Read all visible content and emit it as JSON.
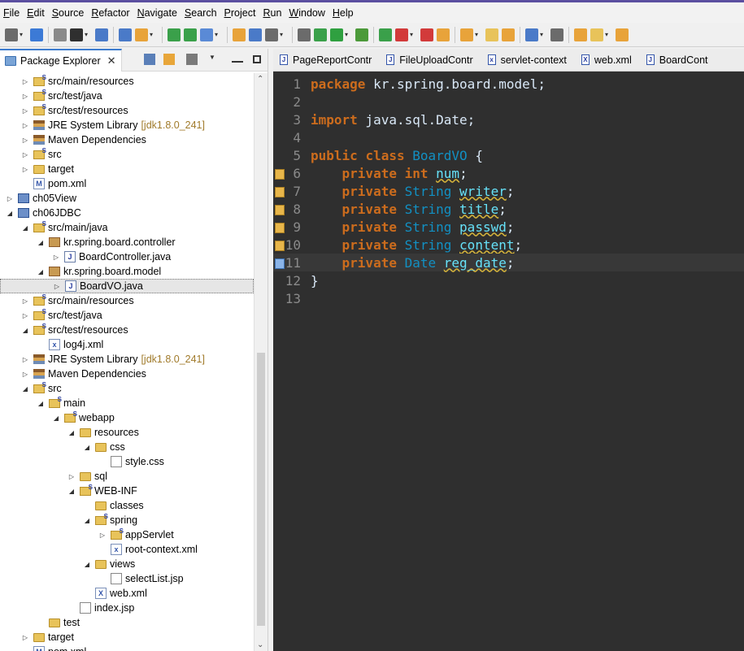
{
  "menu": [
    "File",
    "Edit",
    "Source",
    "Refactor",
    "Navigate",
    "Search",
    "Project",
    "Run",
    "Window",
    "Help"
  ],
  "explorer": {
    "tab_label": "Package Explorer",
    "close_glyph": "✕",
    "rows": [
      {
        "indent": 2,
        "twisty": "closed",
        "icon": "srcfolder",
        "label": "src/main/resources"
      },
      {
        "indent": 2,
        "twisty": "closed",
        "icon": "srcfolder",
        "label": "src/test/java"
      },
      {
        "indent": 2,
        "twisty": "closed",
        "icon": "srcfolder",
        "label": "src/test/resources"
      },
      {
        "indent": 2,
        "twisty": "closed",
        "icon": "lib",
        "label": "JRE System Library",
        "extra": "[jdk1.8.0_241]"
      },
      {
        "indent": 2,
        "twisty": "closed",
        "icon": "lib",
        "label": "Maven Dependencies"
      },
      {
        "indent": 2,
        "twisty": "closed",
        "icon": "srcfolder",
        "label": "src"
      },
      {
        "indent": 2,
        "twisty": "closed",
        "icon": "folder",
        "label": "target"
      },
      {
        "indent": 2,
        "twisty": "none",
        "icon": "xml",
        "label": "pom.xml",
        "glyph": "M"
      },
      {
        "indent": 1,
        "twisty": "closed",
        "icon": "project",
        "label": "ch05View"
      },
      {
        "indent": 1,
        "twisty": "open",
        "icon": "project",
        "label": "ch06JDBC"
      },
      {
        "indent": 2,
        "twisty": "open",
        "icon": "srcfolder",
        "label": "src/main/java"
      },
      {
        "indent": 3,
        "twisty": "open",
        "icon": "pkg",
        "label": "kr.spring.board.controller"
      },
      {
        "indent": 4,
        "twisty": "closed",
        "icon": "java",
        "label": "BoardController.java",
        "glyph": "J"
      },
      {
        "indent": 3,
        "twisty": "open",
        "icon": "pkg",
        "label": "kr.spring.board.model"
      },
      {
        "indent": 4,
        "twisty": "closed",
        "icon": "java",
        "label": "BoardVO.java",
        "glyph": "J",
        "selected": true
      },
      {
        "indent": 2,
        "twisty": "closed",
        "icon": "srcfolder",
        "label": "src/main/resources"
      },
      {
        "indent": 2,
        "twisty": "closed",
        "icon": "srcfolder",
        "label": "src/test/java"
      },
      {
        "indent": 2,
        "twisty": "open",
        "icon": "srcfolder",
        "label": "src/test/resources"
      },
      {
        "indent": 3,
        "twisty": "none",
        "icon": "xml",
        "label": "log4j.xml",
        "glyph": "x"
      },
      {
        "indent": 2,
        "twisty": "closed",
        "icon": "lib",
        "label": "JRE System Library",
        "extra": "[jdk1.8.0_241]"
      },
      {
        "indent": 2,
        "twisty": "closed",
        "icon": "lib",
        "label": "Maven Dependencies"
      },
      {
        "indent": 2,
        "twisty": "open",
        "icon": "srcfolder",
        "label": "src"
      },
      {
        "indent": 3,
        "twisty": "open",
        "icon": "srcfolder",
        "label": "main"
      },
      {
        "indent": 4,
        "twisty": "open",
        "icon": "srcfolder",
        "label": "webapp"
      },
      {
        "indent": 5,
        "twisty": "open",
        "icon": "folder",
        "label": "resources"
      },
      {
        "indent": 6,
        "twisty": "open",
        "icon": "folder",
        "label": "css"
      },
      {
        "indent": 7,
        "twisty": "none",
        "icon": "file",
        "label": "style.css"
      },
      {
        "indent": 5,
        "twisty": "closed",
        "icon": "folder",
        "label": "sql"
      },
      {
        "indent": 5,
        "twisty": "open",
        "icon": "srcfolder",
        "label": "WEB-INF"
      },
      {
        "indent": 6,
        "twisty": "none",
        "icon": "folder",
        "label": "classes"
      },
      {
        "indent": 6,
        "twisty": "open",
        "icon": "srcfolder",
        "label": "spring"
      },
      {
        "indent": 7,
        "twisty": "closed",
        "icon": "srcfolder",
        "label": "appServlet"
      },
      {
        "indent": 7,
        "twisty": "none",
        "icon": "xml",
        "label": "root-context.xml",
        "glyph": "x"
      },
      {
        "indent": 6,
        "twisty": "open",
        "icon": "folder",
        "label": "views"
      },
      {
        "indent": 7,
        "twisty": "none",
        "icon": "file",
        "label": "selectList.jsp"
      },
      {
        "indent": 6,
        "twisty": "none",
        "icon": "xml",
        "label": "web.xml",
        "glyph": "X"
      },
      {
        "indent": 5,
        "twisty": "none",
        "icon": "file",
        "label": "index.jsp"
      },
      {
        "indent": 3,
        "twisty": "none",
        "icon": "folder",
        "label": "test"
      },
      {
        "indent": 2,
        "twisty": "closed",
        "icon": "folder",
        "label": "target"
      },
      {
        "indent": 2,
        "twisty": "none",
        "icon": "xml",
        "label": "pom.xml",
        "glyph": "M"
      }
    ]
  },
  "editor": {
    "tabs": [
      {
        "label": "PageReportContr",
        "glyph": "J"
      },
      {
        "label": "FileUploadContr",
        "glyph": "J"
      },
      {
        "label": "servlet-context",
        "glyph": "x"
      },
      {
        "label": "web.xml",
        "glyph": "X"
      },
      {
        "label": "BoardCont",
        "glyph": "J"
      }
    ],
    "lines": [
      {
        "n": "1",
        "tokens": [
          [
            "kw",
            "package"
          ],
          [
            "t",
            " kr.spring.board.model;"
          ]
        ]
      },
      {
        "n": "2",
        "tokens": []
      },
      {
        "n": "3",
        "tokens": [
          [
            "kw",
            "import"
          ],
          [
            "t",
            " java.sql.Date;"
          ]
        ]
      },
      {
        "n": "4",
        "tokens": []
      },
      {
        "n": "5",
        "tokens": [
          [
            "kw",
            "public"
          ],
          [
            "t",
            " "
          ],
          [
            "kw",
            "class"
          ],
          [
            "t",
            " "
          ],
          [
            "cls",
            "BoardVO"
          ],
          [
            "t",
            " {"
          ]
        ]
      },
      {
        "n": "6",
        "marker": "warn",
        "tokens": [
          [
            "t",
            "    "
          ],
          [
            "kw",
            "private"
          ],
          [
            "t",
            " "
          ],
          [
            "kw",
            "int"
          ],
          [
            "t",
            " "
          ],
          [
            "fld",
            "num"
          ],
          [
            "t",
            ";"
          ]
        ]
      },
      {
        "n": "7",
        "marker": "warn",
        "tokens": [
          [
            "t",
            "    "
          ],
          [
            "kw",
            "private"
          ],
          [
            "t",
            " "
          ],
          [
            "ty",
            "String"
          ],
          [
            "t",
            " "
          ],
          [
            "fld",
            "writer"
          ],
          [
            "t",
            ";"
          ]
        ]
      },
      {
        "n": "8",
        "marker": "warn",
        "tokens": [
          [
            "t",
            "    "
          ],
          [
            "kw",
            "private"
          ],
          [
            "t",
            " "
          ],
          [
            "ty",
            "String"
          ],
          [
            "t",
            " "
          ],
          [
            "fld",
            "title"
          ],
          [
            "t",
            ";"
          ]
        ]
      },
      {
        "n": "9",
        "marker": "warn",
        "tokens": [
          [
            "t",
            "    "
          ],
          [
            "kw",
            "private"
          ],
          [
            "t",
            " "
          ],
          [
            "ty",
            "String"
          ],
          [
            "t",
            " "
          ],
          [
            "fld",
            "passwd"
          ],
          [
            "t",
            ";"
          ]
        ]
      },
      {
        "n": "10",
        "marker": "warn",
        "tokens": [
          [
            "t",
            "    "
          ],
          [
            "kw",
            "private"
          ],
          [
            "t",
            " "
          ],
          [
            "ty",
            "String"
          ],
          [
            "t",
            " "
          ],
          [
            "fld",
            "content"
          ],
          [
            "t",
            ";"
          ]
        ]
      },
      {
        "n": "11",
        "marker": "info",
        "current": true,
        "tokens": [
          [
            "t",
            "    "
          ],
          [
            "kw",
            "private"
          ],
          [
            "t",
            " "
          ],
          [
            "ty",
            "Date"
          ],
          [
            "t",
            " "
          ],
          [
            "fld",
            "reg_date"
          ],
          [
            "t",
            ";"
          ]
        ]
      },
      {
        "n": "12",
        "tokens": [
          [
            "t",
            "}"
          ]
        ]
      },
      {
        "n": "13",
        "tokens": []
      }
    ]
  },
  "colors": {
    "keyword": "#cc6c1d",
    "type": "#1290c3",
    "field": "#66e1f8",
    "editor_bg": "#2f2f2f",
    "selection": "#e6e6e6"
  }
}
